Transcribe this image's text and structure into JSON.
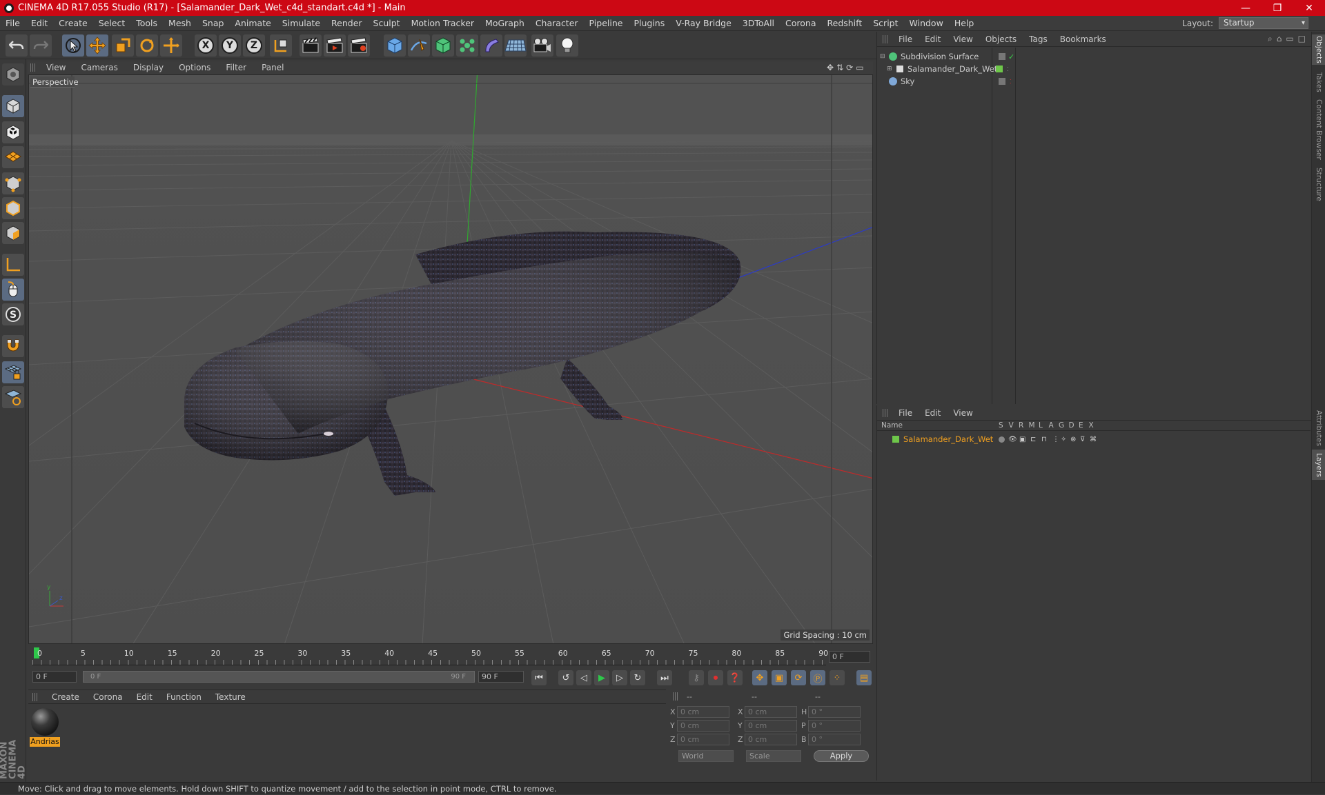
{
  "window": {
    "title": "CINEMA 4D R17.055 Studio (R17) - [Salamander_Dark_Wet_c4d_standart.c4d *] - Main",
    "minimize": "—",
    "maximize": "❐",
    "close": "✕"
  },
  "menubar": {
    "items": [
      "File",
      "Edit",
      "Create",
      "Select",
      "Tools",
      "Mesh",
      "Snap",
      "Animate",
      "Simulate",
      "Render",
      "Sculpt",
      "Motion Tracker",
      "MoGraph",
      "Character",
      "Pipeline",
      "Plugins",
      "V-Ray Bridge",
      "3DToAll",
      "Corona",
      "Redshift",
      "Script",
      "Window",
      "Help"
    ],
    "layout_label": "Layout:",
    "layout_value": "Startup"
  },
  "toolbar": {
    "axis_x": "X",
    "axis_y": "Y",
    "axis_z": "Z"
  },
  "viewport": {
    "menu": [
      "View",
      "Cameras",
      "Display",
      "Options",
      "Filter",
      "Panel"
    ],
    "label": "Perspective",
    "grid_spacing": "Grid Spacing : 10 cm"
  },
  "timeline": {
    "ticks": [
      "0",
      "5",
      "10",
      "15",
      "20",
      "25",
      "30",
      "35",
      "40",
      "45",
      "50",
      "55",
      "60",
      "65",
      "70",
      "75",
      "80",
      "85",
      "90"
    ],
    "current_frame": "0 F",
    "start_field": "0 F",
    "range_start": "0 F",
    "range_end": "90 F",
    "end_field": "90 F"
  },
  "materials": {
    "menu": [
      "Create",
      "Corona",
      "Edit",
      "Function",
      "Texture"
    ],
    "items": [
      {
        "name": "Andrias"
      }
    ]
  },
  "coordinates": {
    "header1": "--",
    "header2": "--",
    "header3": "--",
    "rows": [
      {
        "a": "X",
        "av": "0 cm",
        "b": "X",
        "bv": "0 cm",
        "c": "H",
        "cv": "0 °"
      },
      {
        "a": "Y",
        "av": "0 cm",
        "b": "Y",
        "bv": "0 cm",
        "c": "P",
        "cv": "0 °"
      },
      {
        "a": "Z",
        "av": "0 cm",
        "b": "Z",
        "bv": "0 cm",
        "c": "B",
        "cv": "0 °"
      }
    ],
    "world": "World",
    "scale": "Scale",
    "apply": "Apply"
  },
  "objects": {
    "menu": [
      "File",
      "Edit",
      "View",
      "Objects",
      "Tags",
      "Bookmarks"
    ],
    "rows": [
      {
        "name": "Subdivision Surface"
      },
      {
        "name": "Salamander_Dark_Wet"
      },
      {
        "name": "Sky"
      }
    ]
  },
  "layers": {
    "menu": [
      "File",
      "Edit",
      "View"
    ],
    "header_name": "Name",
    "flags": [
      "S",
      "V",
      "R",
      "M",
      "L",
      "A",
      "G",
      "D",
      "E",
      "X"
    ],
    "rows": [
      {
        "name": "Salamander_Dark_Wet",
        "color": "#6ec64a"
      }
    ]
  },
  "right_tabs": [
    "Objects",
    "Takes",
    "Content Browser",
    "Structure",
    "Attributes",
    "Layers"
  ],
  "status": "Move: Click and drag to move elements. Hold down SHIFT to quantize movement / add to the selection in point mode, CTRL to remove.",
  "maxon_logo": "MAXON CINEMA 4D",
  "colors": {
    "titlebar": "#cc0814",
    "accent_orange": "#f0a020",
    "active_blue": "#5b6b82"
  }
}
